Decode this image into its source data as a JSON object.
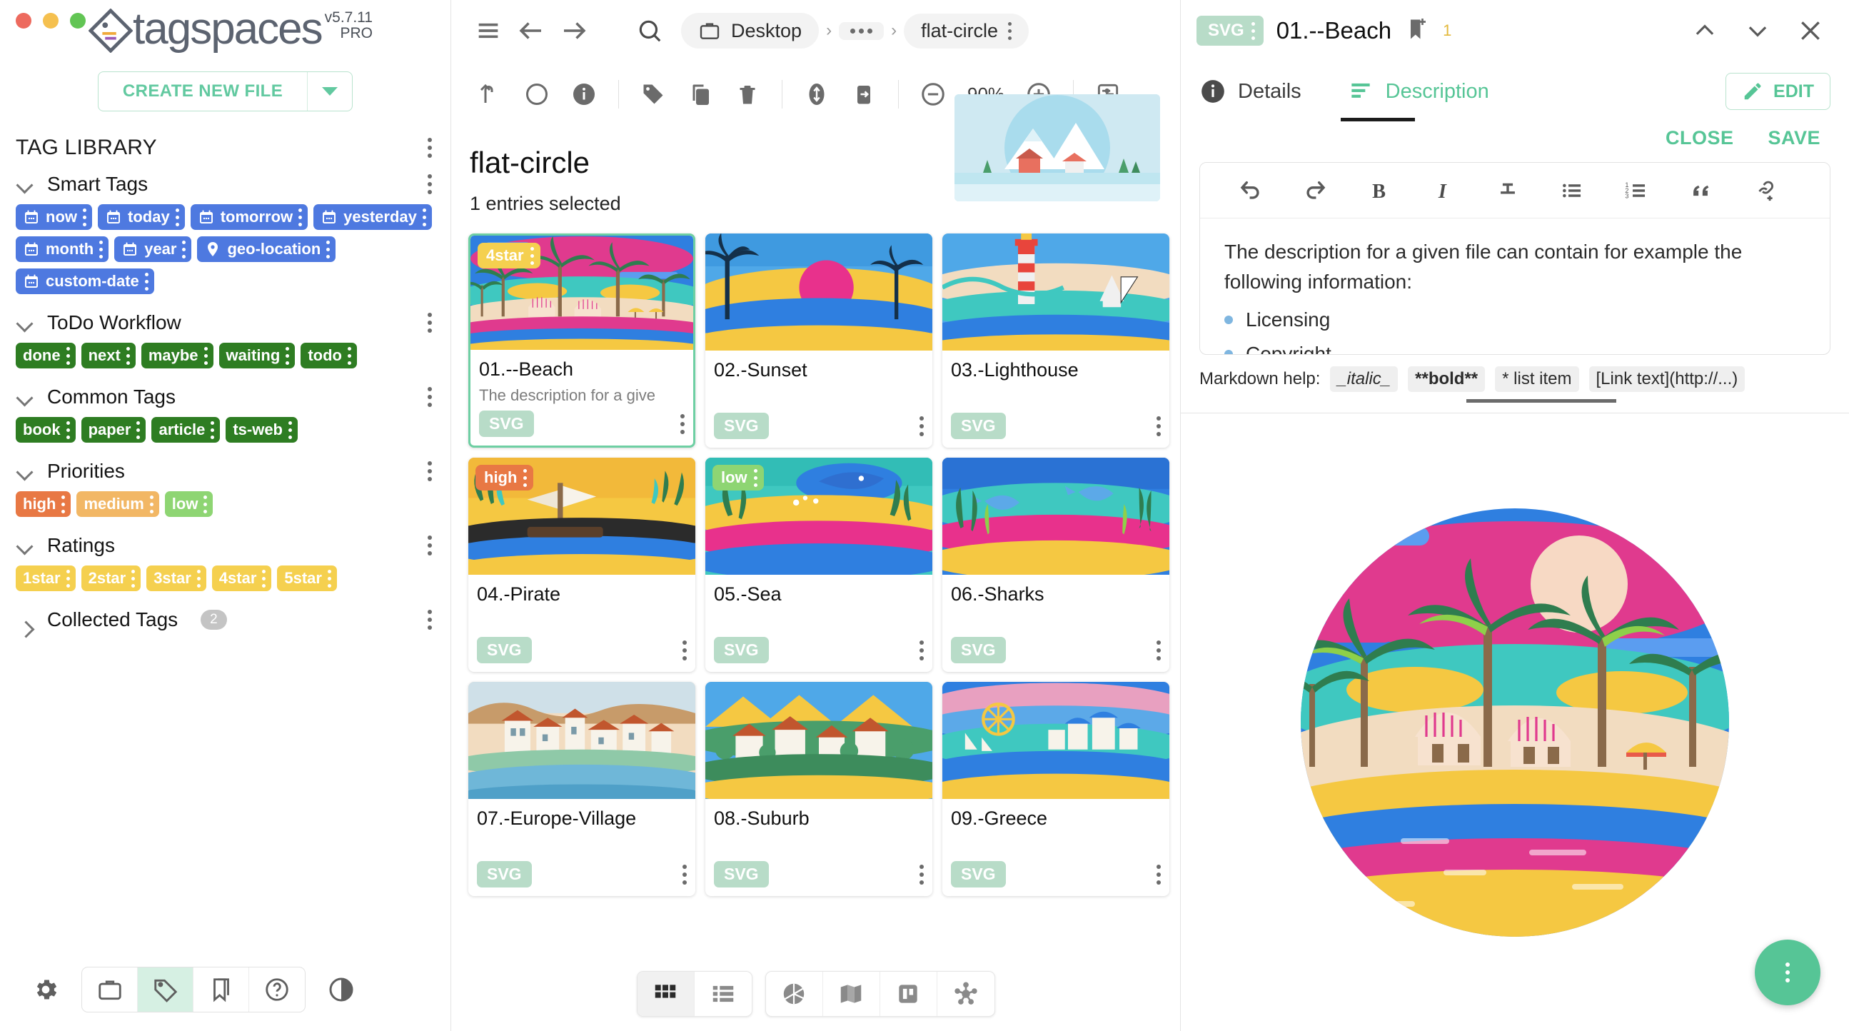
{
  "window": {
    "traffic_lights": [
      "close",
      "minimize",
      "maximize"
    ]
  },
  "brand": {
    "name": "tagspaces",
    "version": "v5.7.11",
    "edition": "PRO"
  },
  "sidebar": {
    "create_button": {
      "label": "CREATE NEW FILE",
      "caret": "chevron-down-icon"
    },
    "tag_library_title": "TAG LIBRARY",
    "sections": [
      {
        "title": "Smart Tags",
        "expanded": true,
        "color": "blue",
        "tags": [
          {
            "label": "now",
            "icon": "calendar-icon"
          },
          {
            "label": "today",
            "icon": "calendar-icon"
          },
          {
            "label": "tomorrow",
            "icon": "calendar-icon"
          },
          {
            "label": "yesterday",
            "icon": "calendar-icon"
          },
          {
            "label": "month",
            "icon": "calendar-icon"
          },
          {
            "label": "year",
            "icon": "calendar-icon"
          },
          {
            "label": "geo-location",
            "icon": "map-pin-icon"
          },
          {
            "label": "custom-date",
            "icon": "calendar-icon"
          }
        ]
      },
      {
        "title": "ToDo Workflow",
        "expanded": true,
        "color": "green",
        "tags": [
          {
            "label": "done"
          },
          {
            "label": "next"
          },
          {
            "label": "maybe"
          },
          {
            "label": "waiting"
          },
          {
            "label": "todo"
          }
        ]
      },
      {
        "title": "Common Tags",
        "expanded": true,
        "color": "green",
        "tags": [
          {
            "label": "book"
          },
          {
            "label": "paper"
          },
          {
            "label": "article"
          },
          {
            "label": "ts-web"
          }
        ]
      },
      {
        "title": "Priorities",
        "expanded": true,
        "color": "mixed",
        "tags": [
          {
            "label": "high",
            "color": "orange"
          },
          {
            "label": "medium",
            "color": "lightorange"
          },
          {
            "label": "low",
            "color": "lightgreen"
          }
        ]
      },
      {
        "title": "Ratings",
        "expanded": true,
        "color": "yellow",
        "tags": [
          {
            "label": "1star"
          },
          {
            "label": "2star"
          },
          {
            "label": "3star"
          },
          {
            "label": "4star"
          },
          {
            "label": "5star"
          }
        ]
      },
      {
        "title": "Collected Tags",
        "expanded": false,
        "color": "none",
        "count": "2",
        "tags": []
      }
    ],
    "bottom_bar": {
      "settings": "gear-icon",
      "nav": [
        {
          "name": "locations",
          "icon": "briefcase-icon",
          "active": false
        },
        {
          "name": "tag-library",
          "icon": "tag-icon",
          "active": true
        },
        {
          "name": "bookmarks",
          "icon": "bookmark-icon",
          "active": false
        },
        {
          "name": "help",
          "icon": "question-circle-icon",
          "active": false
        }
      ],
      "theme_toggle": "contrast-icon"
    }
  },
  "center": {
    "topbar": {
      "menu": "hamburger-icon",
      "back": "arrow-left-icon",
      "forward": "arrow-right-icon",
      "search": "search-icon",
      "breadcrumb": [
        {
          "label": "Desktop",
          "icon": "briefcase-icon"
        },
        {
          "label": "...",
          "icon": "ellipsis-icon"
        },
        {
          "label": "flat-circle",
          "icon": ""
        }
      ]
    },
    "toolbar": {
      "items": [
        "arrow-up-icon",
        "circle-icon",
        "info-icon",
        "tag-icon",
        "copy-icon",
        "trash-icon",
        "move-icon",
        "export-icon"
      ],
      "zoom_out": "minus-circle-icon",
      "zoom_level": "90%",
      "zoom_in": "plus-circle-icon",
      "panel_toggle": "panel-toggle-icon"
    },
    "folder_title": "flat-circle",
    "selection_status": "1 entries selected",
    "files": [
      {
        "name": "01.--Beach",
        "desc": "The description for a give",
        "type": "SVG",
        "tag": "4star",
        "tag_color": "yellow",
        "selected": true,
        "art": "beach"
      },
      {
        "name": "02.-Sunset",
        "desc": "",
        "type": "SVG",
        "tag": "",
        "tag_color": "",
        "selected": false,
        "art": "sunset"
      },
      {
        "name": "03.-Lighthouse",
        "desc": "",
        "type": "SVG",
        "tag": "",
        "tag_color": "",
        "selected": false,
        "art": "lighthouse"
      },
      {
        "name": "04.-Pirate",
        "desc": "",
        "type": "SVG",
        "tag": "high",
        "tag_color": "orange",
        "selected": false,
        "art": "pirate"
      },
      {
        "name": "05.-Sea",
        "desc": "",
        "type": "SVG",
        "tag": "low",
        "tag_color": "lightgreen",
        "selected": false,
        "art": "sea"
      },
      {
        "name": "06.-Sharks",
        "desc": "",
        "type": "SVG",
        "tag": "",
        "tag_color": "",
        "selected": false,
        "art": "sharks"
      },
      {
        "name": "07.-Europe-Village",
        "desc": "",
        "type": "SVG",
        "tag": "",
        "tag_color": "",
        "selected": false,
        "art": "village"
      },
      {
        "name": "08.-Suburb",
        "desc": "",
        "type": "SVG",
        "tag": "",
        "tag_color": "",
        "selected": false,
        "art": "suburb"
      },
      {
        "name": "09.-Greece",
        "desc": "",
        "type": "SVG",
        "tag": "",
        "tag_color": "",
        "selected": false,
        "art": "greece"
      }
    ],
    "view_modes": [
      {
        "name": "grid",
        "icon": "grid-icon",
        "active": true
      },
      {
        "name": "list",
        "icon": "list-icon",
        "active": false
      },
      {
        "name": "gallery",
        "icon": "aperture-icon",
        "active": false
      },
      {
        "name": "map",
        "icon": "map-icon",
        "active": false
      },
      {
        "name": "kanban",
        "icon": "kanban-icon",
        "active": false
      },
      {
        "name": "mindmap",
        "icon": "mindmap-icon",
        "active": false
      }
    ]
  },
  "right": {
    "file_type": "SVG",
    "file_name": "01.--Beach",
    "bookmark_icon": "bookmark-add-icon",
    "tag_count": "1",
    "nav_prev": "chevron-up-icon",
    "nav_next": "chevron-down-icon",
    "close": "close-icon",
    "tabs": [
      {
        "label": "Details",
        "icon": "info-icon",
        "active": false
      },
      {
        "label": "Description",
        "icon": "description-icon",
        "active": true
      }
    ],
    "edit_button": {
      "label": "EDIT",
      "icon": "pencil-icon"
    },
    "actions": [
      {
        "label": "CLOSE"
      },
      {
        "label": "SAVE"
      }
    ],
    "editor_toolbar": [
      "undo-icon",
      "redo-icon",
      "bold-icon",
      "italic-icon",
      "strikethrough-icon",
      "bullet-list-icon",
      "numbered-list-icon",
      "quote-icon",
      "link-icon"
    ],
    "description": {
      "paragraph": "The description for a given file can contain for example the following information:",
      "items": [
        "Licensing",
        "Copyright"
      ]
    },
    "markdown_help": {
      "label": "Markdown help:",
      "chips": [
        "_italic_",
        "**bold**",
        "* list item",
        "[Link text](http://...)"
      ]
    },
    "fab": "more-options-icon"
  },
  "colors": {
    "accent_green": "#56c596",
    "tag_blue": "#4e79e0",
    "tag_green": "#2e7d22",
    "tag_yellow": "#f5d04f",
    "tag_orange": "#e87844",
    "selection_border": "#6ecfa3"
  }
}
